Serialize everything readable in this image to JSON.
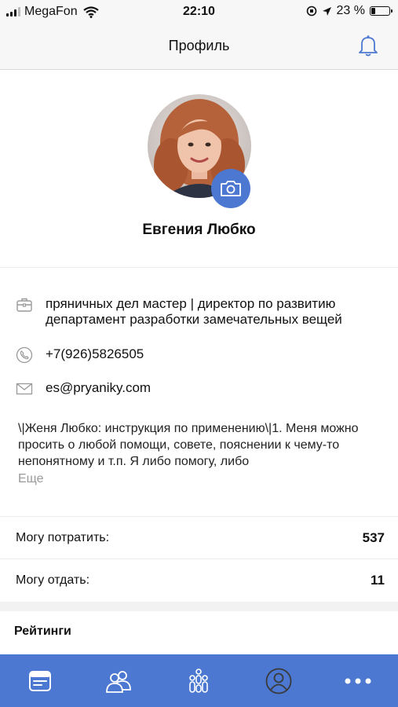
{
  "status_bar": {
    "carrier": "MegaFon",
    "time": "22:10",
    "battery_percent": "23 %",
    "battery_level": 0.23
  },
  "header": {
    "title": "Профиль"
  },
  "profile": {
    "name": "Евгения Любко"
  },
  "info": {
    "position": "пряничных дел мастер | директор по развитию",
    "department": "департамент разработки замечательных вещей",
    "phone": "+7(926)5826505",
    "email": "es@pryaniky.com",
    "bio": "\\|Женя Любко: инструкция по применению\\|1. Меня можно просить о любой помощи, совете, пояснении к чему-то непонятному и т.п. Я либо помогу, либо",
    "more_label": "Еще"
  },
  "stats": [
    {
      "label": "Могу потратить:",
      "value": "537"
    },
    {
      "label": "Могу отдать:",
      "value": "11"
    }
  ],
  "ratings": {
    "title": "Рейтинги"
  },
  "colors": {
    "accent": "#4c78d1",
    "tabbar": "#4c78d1"
  },
  "tabbar": {
    "icons": [
      "news-feed-icon",
      "people-icon",
      "groups-icon",
      "profile-icon",
      "more-icon"
    ]
  }
}
